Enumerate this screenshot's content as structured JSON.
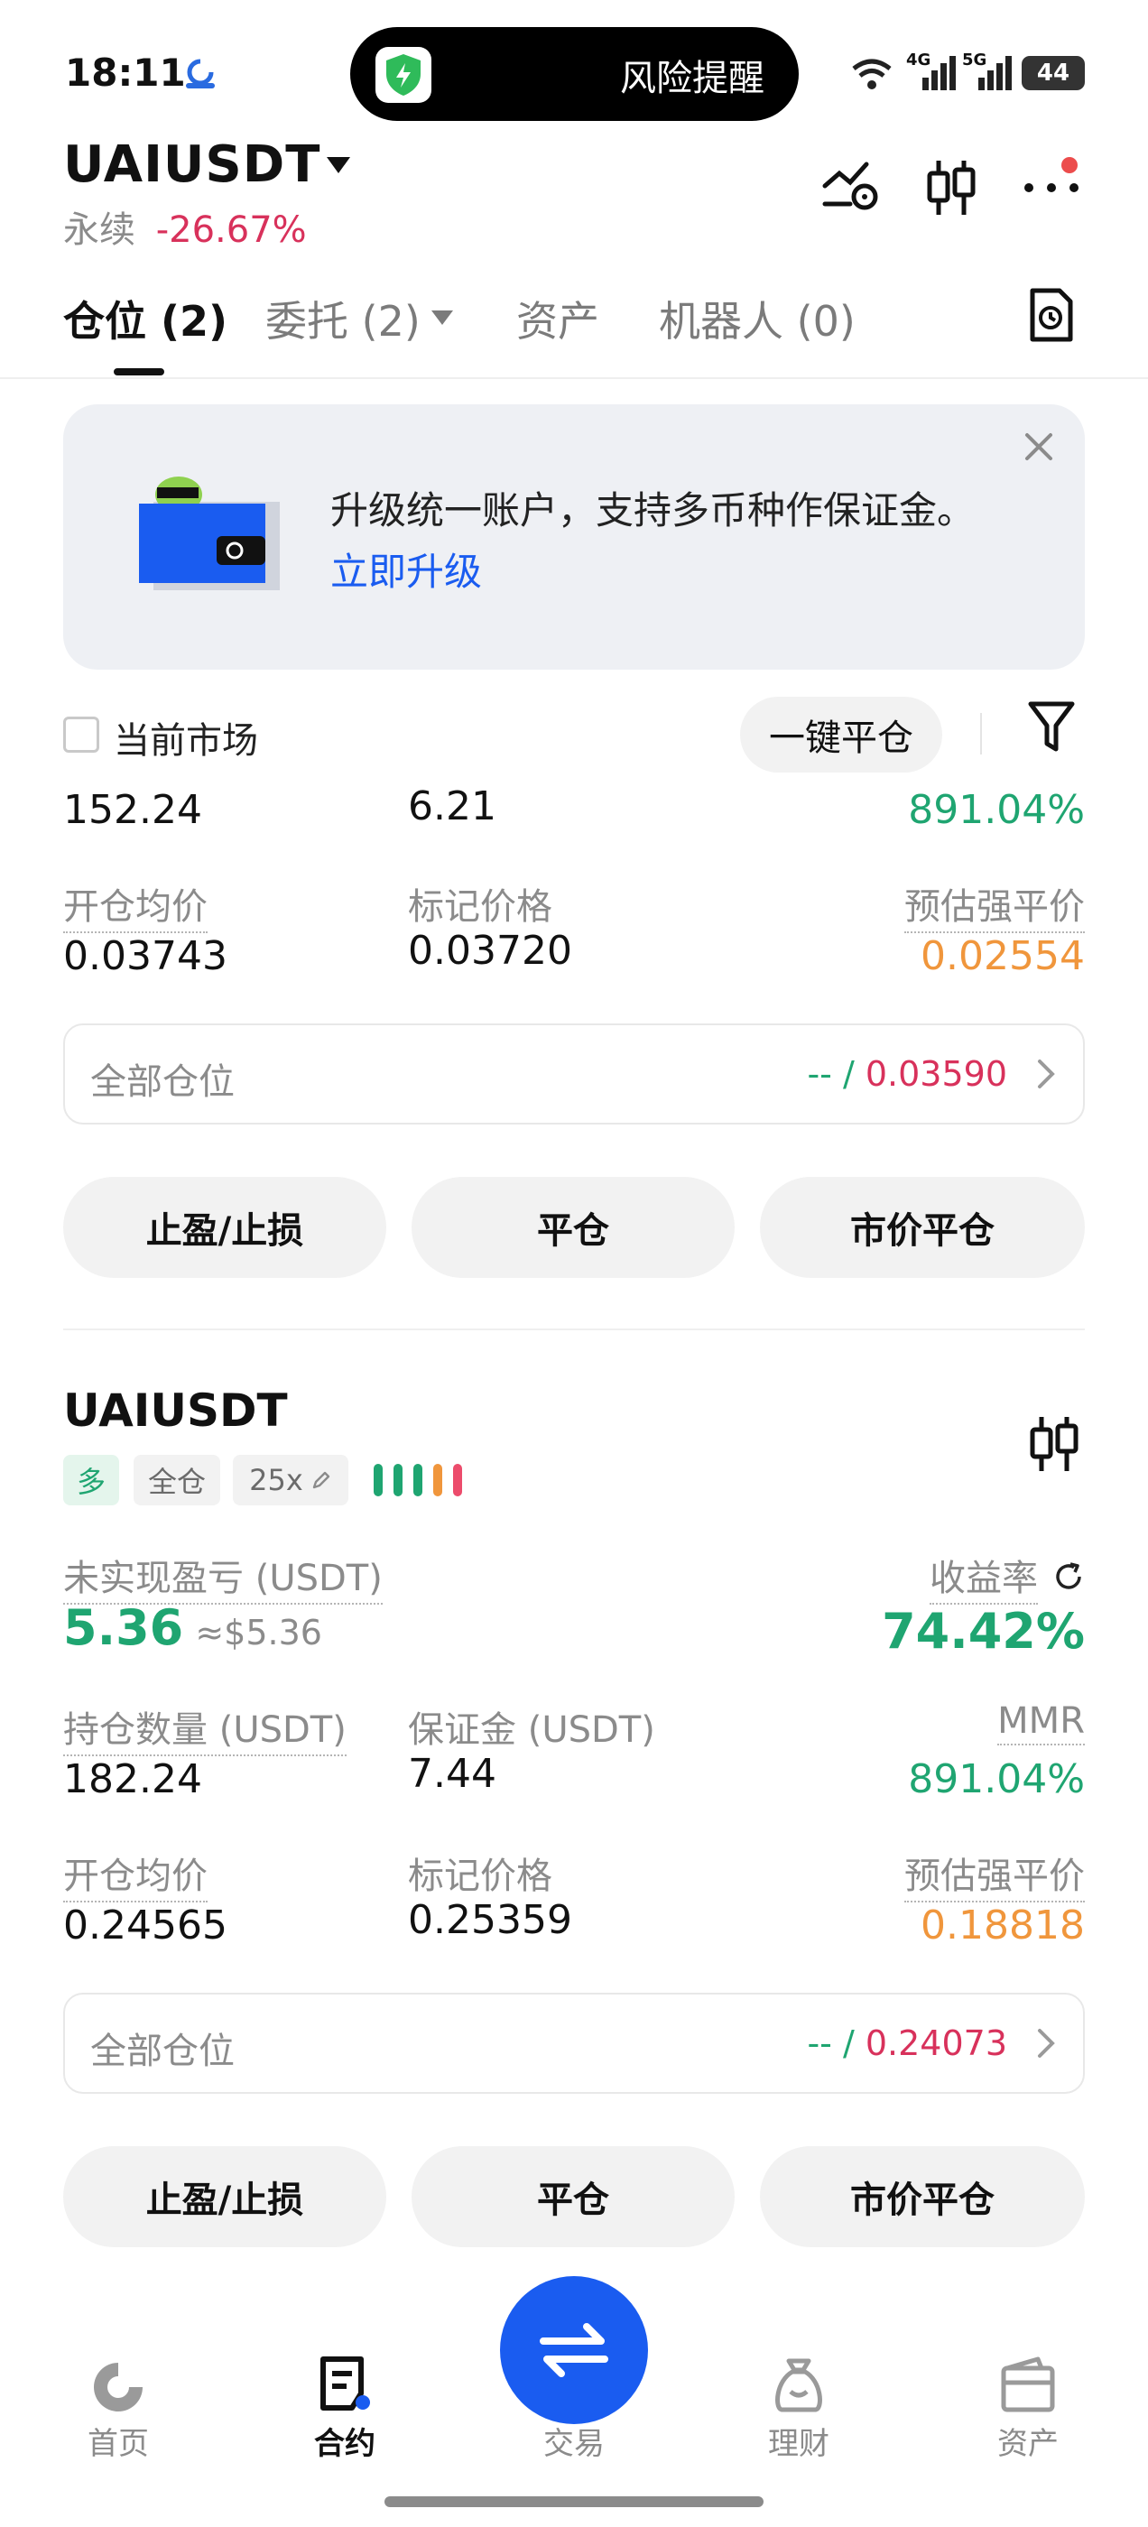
{
  "status_bar": {
    "time": "18:11",
    "island_text": "风险提醒",
    "battery": "44",
    "network_1": "4G",
    "network_2": "5G"
  },
  "header": {
    "symbol": "UAIUSDT",
    "subtitle": "永续",
    "change": "-26.67%"
  },
  "tabs": [
    {
      "label": "仓位 (2)"
    },
    {
      "label": "委托 (2)"
    },
    {
      "label": "资产"
    },
    {
      "label": "机器人 (0)"
    }
  ],
  "banner": {
    "text": "升级统一账户，支持多币种作保证金。",
    "link": "立即升级"
  },
  "filter_bar": {
    "current_market": "当前市场",
    "close_all": "一键平仓"
  },
  "position_1": {
    "qty": "152.24",
    "margin": "6.21",
    "mmr": "891.04%",
    "open_price_label": "开仓均价",
    "open_price": "0.03743",
    "mark_price_label": "标记价格",
    "mark_price": "0.03720",
    "liq_label": "预估强平价",
    "liq_price": "0.02554",
    "all_label": "全部仓位",
    "all_dash": "-- /",
    "all_value": "0.03590",
    "btn_tpsl": "止盈/止损",
    "btn_close": "平仓",
    "btn_market_close": "市价平仓"
  },
  "position_2": {
    "symbol": "UAIUSDT",
    "tag_side": "多",
    "tag_mode": "全仓",
    "tag_leverage": "25x",
    "upnl_label": "未实现盈亏 (USDT)",
    "upnl": "5.36",
    "upnl_usd": "≈$5.36",
    "roe_label": "收益率",
    "roe": "74.42%",
    "qty_label": "持仓数量 (USDT)",
    "qty": "182.24",
    "margin_label": "保证金 (USDT)",
    "margin": "7.44",
    "mmr_label": "MMR",
    "mmr": "891.04%",
    "open_price_label": "开仓均价",
    "open_price": "0.24565",
    "mark_price_label": "标记价格",
    "mark_price": "0.25359",
    "liq_label": "预估强平价",
    "liq_price": "0.18818",
    "all_label": "全部仓位",
    "all_dash": "-- /",
    "all_value": "0.24073",
    "btn_tpsl": "止盈/止损",
    "btn_close": "平仓",
    "btn_market_close": "市价平仓"
  },
  "bottom_nav": [
    {
      "label": "首页",
      "icon": "home-icon"
    },
    {
      "label": "合约",
      "icon": "contract-icon"
    },
    {
      "label": "交易",
      "icon": "swap-icon"
    },
    {
      "label": "理财",
      "icon": "finance-icon"
    },
    {
      "label": "资产",
      "icon": "wallet-icon"
    }
  ],
  "colors": {
    "accent": "#1a5cf0",
    "green": "#1fa571",
    "red": "#d8315b",
    "orange": "#f0963c"
  }
}
